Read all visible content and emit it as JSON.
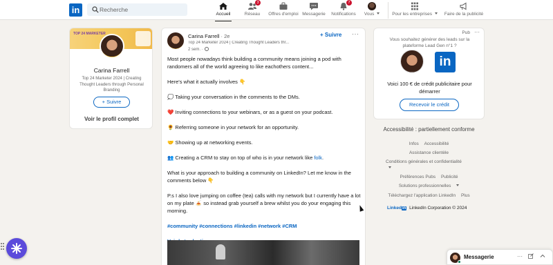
{
  "nav": {
    "search_placeholder": "Recherche",
    "items": [
      {
        "label": "Accueil",
        "icon": "home-icon",
        "badge": ""
      },
      {
        "label": "Réseau",
        "icon": "network-icon",
        "badge": "3"
      },
      {
        "label": "Offres d'emploi",
        "icon": "briefcase-icon",
        "badge": ""
      },
      {
        "label": "Messagerie",
        "icon": "messaging-icon",
        "badge": ""
      },
      {
        "label": "Notifications",
        "icon": "bell-icon",
        "badge": "7"
      },
      {
        "label": "Vous",
        "icon": "avatar",
        "badge": ""
      },
      {
        "label": "Pour les entreprises",
        "icon": "grid-icon",
        "badge": ""
      },
      {
        "label": "Faire de la publicité",
        "icon": "megaphone-icon",
        "badge": ""
      }
    ]
  },
  "profile": {
    "banner_text": "TOP 24 MARKETER",
    "name": "Carina Farrell",
    "headline": "Top 24 Marketer 2024 | Creating Thought Leaders through Personal Branding",
    "follow_label": "+ Suivre",
    "view_profile": "Voir le profil complet"
  },
  "post": {
    "author": "Carina Farrell",
    "degree": "· 2e",
    "headline": "Top 24 Marketer 2024 | Creating Thought Leaders thr...",
    "time": "2 sem. ·",
    "follow_label": "+ Suivre",
    "more": "···",
    "paragraphs": [
      "Most people nowadays think building a community means joining a pod with randomers all of the world agreeing to like eachothers content...",
      "Here's what it actually involves 👇",
      "💭 Taking your conversation in the comments to the DMs.",
      "❤️ Inviting connections to your webinars, or as a guest on your podcast.",
      "🌻 Referring someone in your network for an opportunity.",
      "🤝 Showing up at networking events."
    ],
    "crm_line_prefix": "👥 Creating a CRM to stay on top of who is in your network like ",
    "crm_link": "folk",
    "crm_line_suffix": ".",
    "question": "What is your approach to building a community on LinkedIn? Let me know in the comments below 👇",
    "ps": "P.s I also love jumping on coffee (tea) calls with my network but I currently have a lot on my plate 🍝 so instead grab yourself a brew whilst you do your engaging this morning.",
    "hashtags": "#community #connections #linkedin #network #CRM",
    "translate": "Voir la traduction"
  },
  "ad": {
    "pub": "Pub",
    "more": "···",
    "question": "Vous souhaitez générer des leads sur la plateforme Lead Gen n°1 ?",
    "logo_text": "in",
    "offer": "Voici 100 € de crédit publicitaire pour démarrer",
    "button": "Recevoir le crédit"
  },
  "footer": {
    "accessibility": "Accessibilité : partiellement conforme",
    "row1": [
      "Infos",
      "Accessibilité"
    ],
    "row2": [
      "Assistance clientèle"
    ],
    "row3": [
      "Conditions générales et confidentialité"
    ],
    "row4": [
      "Préférences Pubs",
      "Publicité"
    ],
    "row5": [
      "Solutions professionnelles"
    ],
    "row6": [
      "Téléchargez l'application LinkedIn",
      "Plus"
    ],
    "brand_word": "Linked",
    "brand_box": "in",
    "copyright": "LinkedIn Corporation © 2024"
  },
  "messaging": {
    "label": "Messagerie",
    "more": "···"
  },
  "colors": {
    "brand": "#0a66c2",
    "badge": "#cb112d",
    "background": "#f4f2ee",
    "fab": "#5b4bdb"
  }
}
